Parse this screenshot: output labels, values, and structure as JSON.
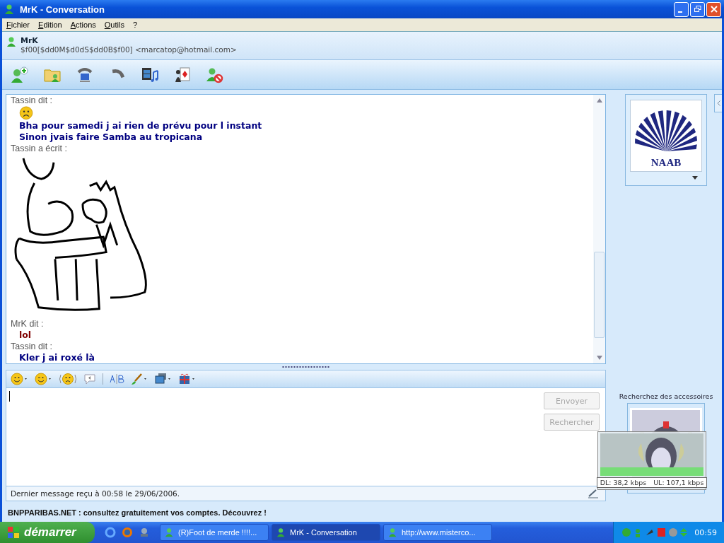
{
  "window": {
    "title": "MrK - Conversation"
  },
  "menu": [
    {
      "label": "Fichier"
    },
    {
      "label": "Edition"
    },
    {
      "label": "Actions"
    },
    {
      "label": "Outils"
    },
    {
      "label": "?"
    }
  ],
  "contact": {
    "name": "MrK",
    "status_line": "$f00[$dd0M$d0dS$dd0B$f00] <marcatop@hotmail.com>"
  },
  "chat": {
    "messages": [
      {
        "kind": "said",
        "header": "Tassin dit :",
        "color": "#000080",
        "items": [
          {
            "kind": "emoticon"
          },
          {
            "kind": "text",
            "text": "Bha pour samedi j ai rien de prévu pour l instant"
          },
          {
            "kind": "text",
            "text": "Sinon jvais faire Samba au tropicana"
          }
        ]
      },
      {
        "kind": "ink",
        "header": "Tassin a écrit :"
      },
      {
        "kind": "said",
        "header": "MrK dit :",
        "color": "#800000",
        "items": [
          {
            "kind": "text",
            "text": "lol"
          }
        ]
      },
      {
        "kind": "said",
        "header": "Tassin dit :",
        "color": "#000080",
        "items": [
          {
            "kind": "text",
            "text": "Kler j ai roxé là"
          }
        ]
      }
    ]
  },
  "input": {
    "buttons": [
      {
        "label": "Envoyer",
        "disabled": true
      },
      {
        "label": "Rechercher",
        "disabled": true
      }
    ]
  },
  "status": "Dernier message reçu à 00:58 le 29/06/2006.",
  "ad": "BNPPARIBAS.NET : consultez gratuitement vos comptes. Découvrez !",
  "sidebar": {
    "avatar_text": "NAAB",
    "accessories_label": "Recherchez des accessoires"
  },
  "bandwidth": {
    "dl": "DL: 38,2 kbps",
    "ul": "UL: 107,1 kbps"
  },
  "taskbar": {
    "start": "démarrer",
    "tasks": [
      {
        "label": "(R)Foot de merde !!!!...",
        "selected": false
      },
      {
        "label": "MrK - Conversation",
        "selected": true
      },
      {
        "label": "http://www.misterco...",
        "selected": false
      }
    ],
    "clock": "00:59"
  }
}
